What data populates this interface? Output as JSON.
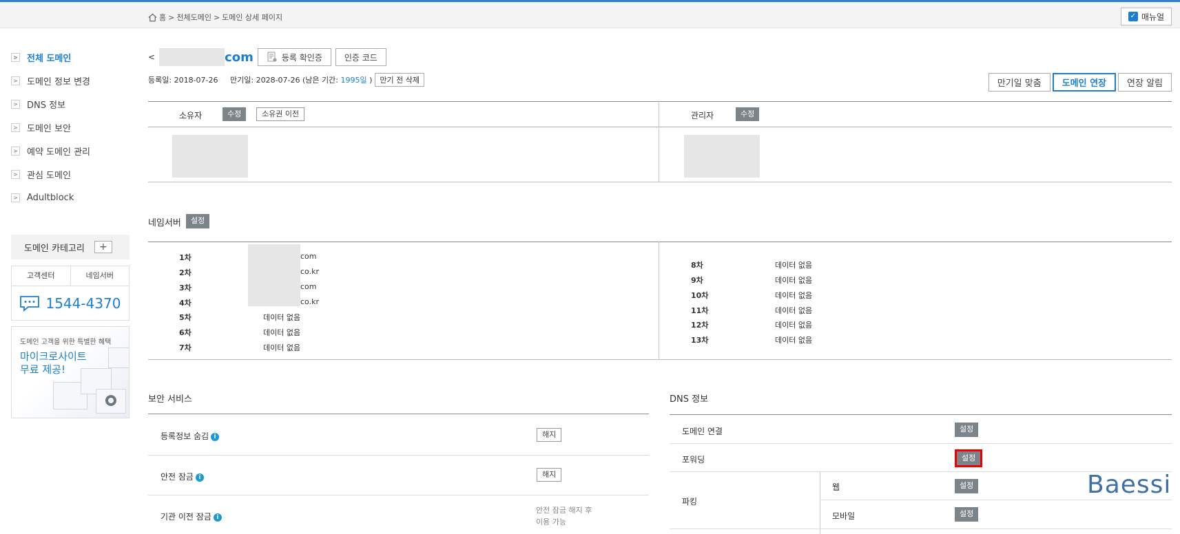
{
  "breadcrumb": {
    "home": "홈",
    "sep1": ">",
    "all": "전체도메인",
    "sep2": ">",
    "current": "도메인 상세 페이지"
  },
  "manual_label": "매뉴얼",
  "sidebar": {
    "items": [
      {
        "label": "전체 도메인",
        "active": true
      },
      {
        "label": "도메인 정보 변경"
      },
      {
        "label": "DNS 정보"
      },
      {
        "label": "도메인 보안"
      },
      {
        "label": "예약 도메인 관리"
      },
      {
        "label": "관심 도메인"
      },
      {
        "label": "Adultblock"
      }
    ]
  },
  "category": {
    "label": "도메인 카테고리",
    "plus": "+"
  },
  "cs": {
    "tab1": "고객센터",
    "tab2": "네임서버",
    "phone": "1544-4370"
  },
  "promo": {
    "line1": "도메인 고객을 위한 특별한 혜택",
    "line2": "마이크로사이트",
    "line3": "무료 제공!"
  },
  "domain": {
    "back": "<",
    "tld": "com",
    "cert_btn": "등록 확인증",
    "auth_btn": "인증 코드"
  },
  "dates": {
    "reg_label": "등록일:",
    "reg": "2018-07-26",
    "exp_label": "만기일:",
    "exp": "2028-07-26",
    "remain_open": "(남은 기간:",
    "remain": "1995일",
    "remain_close": ")",
    "del_btn": "만기 전 삭제"
  },
  "actions": {
    "match": "만기일 맞춤",
    "extend": "도메인 연장",
    "notify": "연장 알림"
  },
  "owner": {
    "label": "소유자",
    "edit": "수정",
    "transfer": "소유권 이전"
  },
  "admin": {
    "label": "관리자",
    "edit": "수정"
  },
  "nameserver": {
    "title": "네임서버",
    "set": "설정",
    "left": [
      {
        "n": "1차",
        "v": "com"
      },
      {
        "n": "2차",
        "v": "co.kr"
      },
      {
        "n": "3차",
        "v": "com"
      },
      {
        "n": "4차",
        "v": "co.kr"
      },
      {
        "n": "5차",
        "v": "데이터 없음"
      },
      {
        "n": "6차",
        "v": "데이터 없음"
      },
      {
        "n": "7차",
        "v": "데이터 없음"
      }
    ],
    "right": [
      {
        "n": "8차",
        "v": "데이터 없음"
      },
      {
        "n": "9차",
        "v": "데이터 없음"
      },
      {
        "n": "10차",
        "v": "데이터 없음"
      },
      {
        "n": "11차",
        "v": "데이터 없음"
      },
      {
        "n": "12차",
        "v": "데이터 없음"
      },
      {
        "n": "13차",
        "v": "데이터 없음"
      }
    ]
  },
  "security": {
    "title": "보안 서비스",
    "rows": [
      {
        "label": "등록정보 숨김",
        "btn": "해지"
      },
      {
        "label": "안전 잠금",
        "btn": "해지"
      },
      {
        "label": "기관 이전 잠금",
        "note1": "안전 잠금 해지 후",
        "note2": "이용 가능"
      }
    ]
  },
  "dns": {
    "title": "DNS 정보",
    "connect": "도메인 연결",
    "forward": "포워딩",
    "parking": "파킹",
    "web": "웹",
    "mobile": "모바일",
    "set": "설정"
  },
  "watermark": "Baessi",
  "colors": {
    "accent": "#1a7fd4",
    "gray_btn": "#7c8389",
    "highlight": "#e00000"
  }
}
